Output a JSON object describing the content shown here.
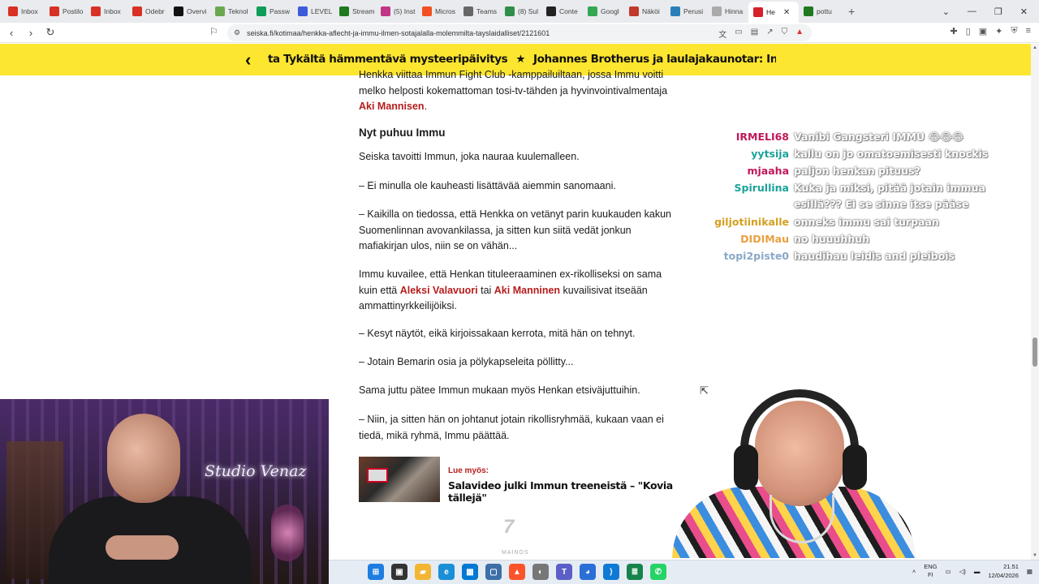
{
  "browser": {
    "tabs": [
      {
        "label": "Inbox",
        "favicon_color": "#d93025",
        "icon": "gmail-icon"
      },
      {
        "label": "Postilo",
        "favicon_color": "#d93025",
        "icon": "gmail-icon"
      },
      {
        "label": "Inbox",
        "favicon_color": "#d93025",
        "icon": "gmail-icon"
      },
      {
        "label": "Odebr",
        "favicon_color": "#d93025",
        "icon": "gmail-icon"
      },
      {
        "label": "Overvi",
        "favicon_color": "#111111",
        "icon": "app-icon"
      },
      {
        "label": "Teknol",
        "favicon_color": "#6aa84f",
        "icon": "shopify-icon"
      },
      {
        "label": "Passw",
        "favicon_color": "#0f9d58",
        "icon": "sheets-icon"
      },
      {
        "label": "LEVEL",
        "favicon_color": "#3b5bdb",
        "icon": "app-icon"
      },
      {
        "label": "Stream",
        "favicon_color": "#1f7a1f",
        "icon": "kick-icon"
      },
      {
        "label": "(5) Inst",
        "favicon_color": "#c13584",
        "icon": "instagram-icon"
      },
      {
        "label": "Micros",
        "favicon_color": "#f25022",
        "icon": "microsoft-icon"
      },
      {
        "label": "Teams",
        "favicon_color": "#666666",
        "icon": "teams-icon"
      },
      {
        "label": "(8) Sul",
        "favicon_color": "#2f8f4a",
        "icon": "app-icon"
      },
      {
        "label": "Conte",
        "favicon_color": "#222222",
        "icon": "app-icon"
      },
      {
        "label": "Googl",
        "favicon_color": "#34a853",
        "icon": "maps-icon"
      },
      {
        "label": "Näköi",
        "favicon_color": "#c0392b",
        "icon": "app-icon"
      },
      {
        "label": "Perusi",
        "favicon_color": "#2980b9",
        "icon": "app-icon"
      },
      {
        "label": "Hinna",
        "favicon_color": "#aaaaaa",
        "icon": "app-icon"
      },
      {
        "label": "He",
        "favicon_color": "#d6202a",
        "icon": "seiska-icon",
        "active": true
      },
      {
        "label": "pottu",
        "favicon_color": "#1f7a1f",
        "icon": "kick-icon"
      }
    ],
    "url": "seiska.fi/kotimaa/henkka-aflecht-ja-immu-ilmen-sotajalalla-molemmilta-tayslaidalliset/2121601"
  },
  "ticker": {
    "items": [
      "ta Tykältä hämmentävä mysteeripäivitys",
      "Johannes Brotherus ja laulajakaunotar: Intiimi kohtaaminen – salakuv"
    ],
    "separator": "★",
    "bg_color": "#fde62f"
  },
  "article": {
    "p0": {
      "before": "Henkka viittaa Immun Fight Club -kamppailuiltaan, jossa Immu voitti melko helposti kokemattoman tosi-tv-tähden ja hyvinvointivalmentaja ",
      "link": "Aki Mannisen",
      "after": "."
    },
    "subheading": "Nyt puhuu Immu",
    "p1": "Seiska tavoitti Immun, joka nauraa kuulemalleen.",
    "p2": "– Ei minulla ole kauheasti lisättävää aiemmin sanomaani.",
    "p3": "– Kaikilla on tiedossa, että Henkka on vetänyt parin kuukauden kakun Suomenlinnan avovankilassa, ja sitten kun siitä vedät jonkun mafiakirjan ulos, niin se on vähän...",
    "p4": {
      "before": "Immu kuvailee, että Henkan tituleeraaminen ex-rikolliseksi on sama kuin että ",
      "link1": "Aleksi Valavuori",
      "mid": " tai ",
      "link2": "Aki Manninen",
      "after": " kuvailisivat itseään ammattinyrkkeilijöiksi."
    },
    "p5": "– Kesyt näytöt, eikä kirjoissakaan kerrota, mitä hän on tehnyt.",
    "p6": "– Jotain Bemarin osia ja pölykapseleita pöllitty...",
    "p7": "Sama juttu pätee Immun mukaan myös Henkan etsiväjuttuihin.",
    "p8": "– Niin, ja sitten hän on johtanut jotain rikollisryhmää, kukaan vaan ei tiedä, mikä ryhmä, Immu päättää.",
    "link_color": "#b71c1c"
  },
  "read_more": {
    "label": "Lue myös:",
    "title": "Salavideo julki Immun treeneistä – \"Kovia tällejä\""
  },
  "ad_label": "MAINOS",
  "chat": [
    {
      "user": "IRMELI68",
      "color": "#c0185a",
      "text": "Vanibi Gangsteri IMMU 😂😂😂"
    },
    {
      "user": "yytsija",
      "color": "#1aa39a",
      "text": "kallu on jo omatoemisesti knockis"
    },
    {
      "user": "mjaaha",
      "color": "#c0185a",
      "text": "paljon henkan pituus?"
    },
    {
      "user": "Spirullina",
      "color": "#1aa39a",
      "text": "Kuka ja miksi, pitää jotain immua"
    },
    {
      "user": "",
      "color": "#1aa39a",
      "text": "esillä??? Ei se sinne itse pääse"
    },
    {
      "user": "giljotiinikalle",
      "color": "#d4a020",
      "text": "onneks immu sai turpaan"
    },
    {
      "user": "DIDIMau",
      "color": "#e8a040",
      "text": "no huuuhhuh"
    },
    {
      "user": "topi2piste0",
      "color": "#8aa8c8",
      "text": "haudihau leidis and pleibois"
    }
  ],
  "webcam": {
    "studio_text": "Studio Venaz"
  },
  "taskbar": {
    "lang_line1": "ENG",
    "lang_line2": "FI",
    "time": "21.51",
    "date": "12/04/2026"
  }
}
